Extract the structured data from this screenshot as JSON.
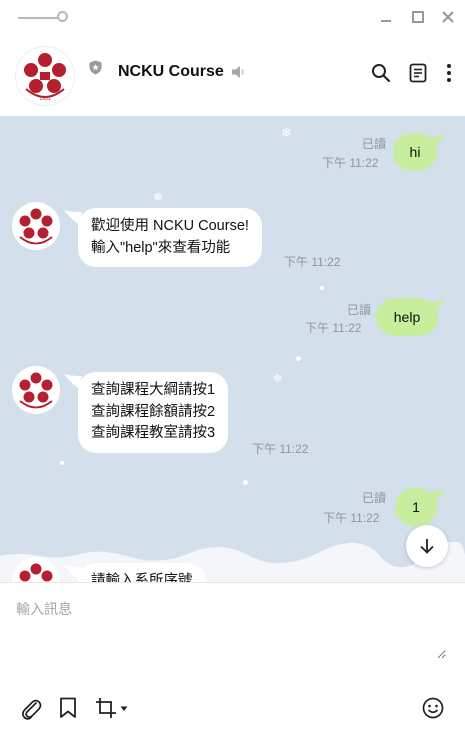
{
  "window": {
    "minimize": "–",
    "maximize": "□",
    "close": "×"
  },
  "header": {
    "title": "NCKU Course"
  },
  "messages": {
    "out1": {
      "text": "hi",
      "read": "已讀",
      "time": "下午 11:22"
    },
    "in1": {
      "line1": "歡迎使用 NCKU Course!",
      "line2": "輸入\"help\"來查看功能",
      "time": "下午 11:22"
    },
    "out2": {
      "text": "help",
      "read": "已讀",
      "time": "下午 11:22"
    },
    "in2": {
      "line1": "查詢課程大綱請按1",
      "line2": "查詢課程餘額請按2",
      "line3": "查詢課程教室請按3",
      "time": "下午 11:22"
    },
    "out3": {
      "text": "1",
      "read": "已讀",
      "time": "下午 11:22"
    },
    "in3": {
      "line1": "請輸入系所序號"
    }
  },
  "composer": {
    "placeholder": "輸入訊息"
  },
  "logo": {
    "year": "1931",
    "color": "#b51f2e"
  },
  "colors": {
    "chat_bg": "#d4dfec",
    "bubble_out": "#c7ee9d",
    "bubble_in": "#ffffff"
  }
}
